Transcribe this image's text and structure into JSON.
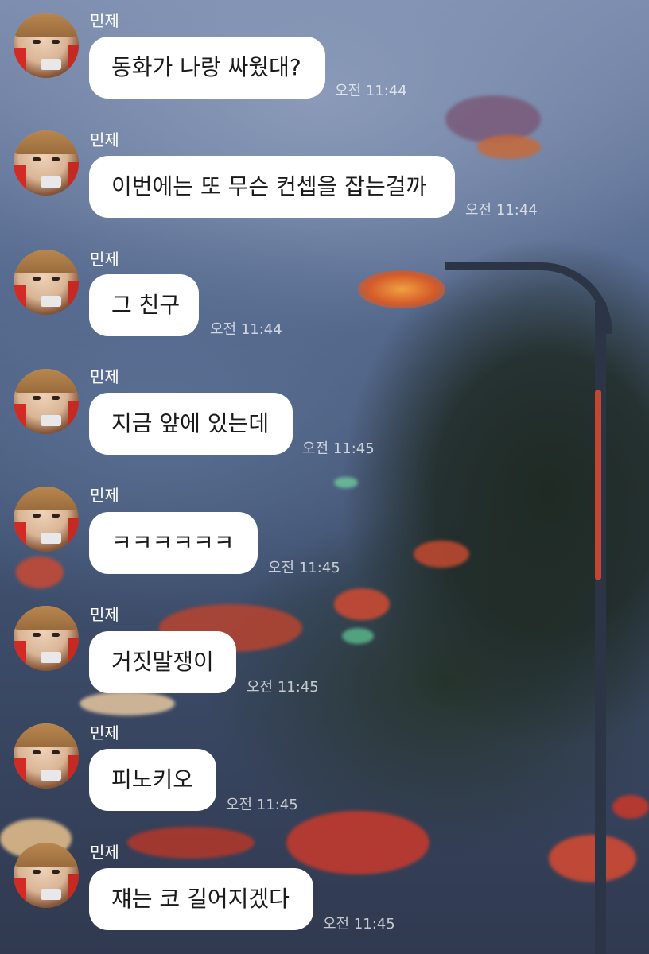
{
  "messages": [
    {
      "sender": "민제",
      "text": "동화가 나랑 싸웠대?",
      "time": "오전 11:44"
    },
    {
      "sender": "민제",
      "text": "이번에는 또 무슨 컨셉을 잡는걸까",
      "time": "오전 11:44"
    },
    {
      "sender": "민제",
      "text": "그 친구",
      "time": "오전 11:44"
    },
    {
      "sender": "민제",
      "text": "지금 앞에 있는데",
      "time": "오전 11:45"
    },
    {
      "sender": "민제",
      "text": "ㅋㅋㅋㅋㅋㅋ",
      "time": "오전 11:45"
    },
    {
      "sender": "민제",
      "text": "거짓말쟁이",
      "time": "오전 11:45"
    },
    {
      "sender": "민제",
      "text": "피노키오",
      "time": "오전 11:45"
    },
    {
      "sender": "민제",
      "text": "쟤는 코 길어지겠다",
      "time": "오전 11:45"
    }
  ]
}
